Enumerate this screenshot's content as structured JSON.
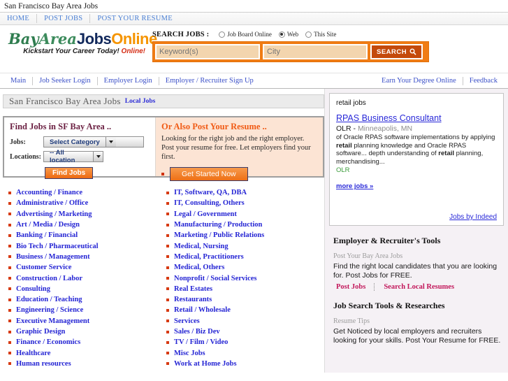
{
  "window": {
    "title": "San Francisco Bay Area Jobs"
  },
  "topnav": {
    "items": [
      {
        "label": "HOME"
      },
      {
        "label": "POST JOBS"
      },
      {
        "label": "POST YOUR RESUME"
      }
    ]
  },
  "brand": {
    "bay": "Bay",
    "area": "Area",
    "jobs": "Jobs",
    "online": "Online",
    "tagline_main": "Kickstart Your Career Today!",
    "tagline_accent": "Online!"
  },
  "search": {
    "label": "SEARCH JOBS :",
    "options": [
      {
        "label": "Job Board Online",
        "selected": false
      },
      {
        "label": "Web",
        "selected": true
      },
      {
        "label": "This Site",
        "selected": false
      }
    ],
    "keyword_placeholder": "Keyword(s)",
    "keyword_value": "",
    "city_placeholder": "City",
    "city_value": "",
    "button_label": "SEARCH",
    "button_icon": "magnifier-icon"
  },
  "subnav": {
    "left_items": [
      {
        "label": "Main"
      },
      {
        "label": "Job Seeker Login"
      },
      {
        "label": "Employer Login"
      },
      {
        "label": "Employer / Recruiter Sign Up"
      }
    ],
    "right_items": [
      {
        "label": "Earn Your Degree Online"
      },
      {
        "label": "Feedback"
      }
    ]
  },
  "page_heading": {
    "title": "San Francisco Bay Area Jobs",
    "sub_link": "Local Jobs"
  },
  "find_panel": {
    "heading": "Find Jobs in SF Bay Area ..",
    "jobs_label": "Jobs:",
    "category_value": "Select Category",
    "locations_label": "Locations:",
    "location_value": "-- All location",
    "find_button": "Find Jobs"
  },
  "resume_panel": {
    "heading": "Or Also Post Your Resume ..",
    "body": "Looking for the right job and the right employer. Post your resume for free. Let employers find your first.",
    "button": "Get Started Now"
  },
  "categories": {
    "column1": [
      "Accounting / Finance",
      "Administrative / Office",
      "Advertising / Marketing",
      "Art / Media / Design",
      "Banking / Financial",
      "Bio Tech / Pharmaceutical",
      "Business / Management",
      "Customer Service",
      "Construction / Labor",
      "Consulting",
      "Education / Teaching",
      "Engineering / Science",
      "Executive Management",
      "Graphic Design",
      "Finance / Economics",
      "Healthcare",
      "Human resources"
    ],
    "column2": [
      "IT, Software, QA, DBA",
      "IT, Consulting, Others",
      "Legal / Government",
      "Manufacturing / Production",
      "Marketing / Public Relations",
      "Medical, Nursing",
      "Medical, Practitioners",
      "Medical, Others",
      "Nonprofit / Social Services",
      "Real Estates",
      "Restaurants",
      "Retail / Wholesale",
      "Services",
      "Sales / Biz Dev",
      "TV / Film / Video",
      "Misc Jobs",
      "Work at Home Jobs"
    ]
  },
  "indeed": {
    "keyword": "retail jobs",
    "job_title": "RPAS Business Consultant",
    "company": "OLR",
    "dash": " - ",
    "location": "Minneapolis, MN",
    "snippet_1": "of Oracle RPAS software implementations by applying ",
    "snippet_b1": "retail",
    "snippet_2": " planning knowledge and Oracle RPAS software... depth understanding of ",
    "snippet_b2": "retail",
    "snippet_3": " planning, merchandising...",
    "source": "OLR",
    "more_link": "more jobs »",
    "footer_link": "Jobs by Indeed"
  },
  "employer_tools": {
    "heading": "Employer & Recruiter's Tools",
    "sub": "Post Your Bay Area Jobs",
    "body": "Find the right local candidates that you are looking for. Post Jobs for FREE.",
    "link_post": "Post Jobs",
    "link_search": "Search Local Resumes"
  },
  "job_tools": {
    "heading": "Job Search Tools & Researches",
    "sub": "Resume Tips",
    "body": "Get Noticed by local employers and recruiters looking for your skills. Post Your Resume for FREE."
  },
  "colors": {
    "orange": "#f07c14",
    "link_blue": "#2525d4",
    "bullet_red": "#d73a12",
    "heading_maroon": "#6b2042",
    "pink_link": "#c2185b",
    "sidebar_bg": "#f5f1f5"
  }
}
